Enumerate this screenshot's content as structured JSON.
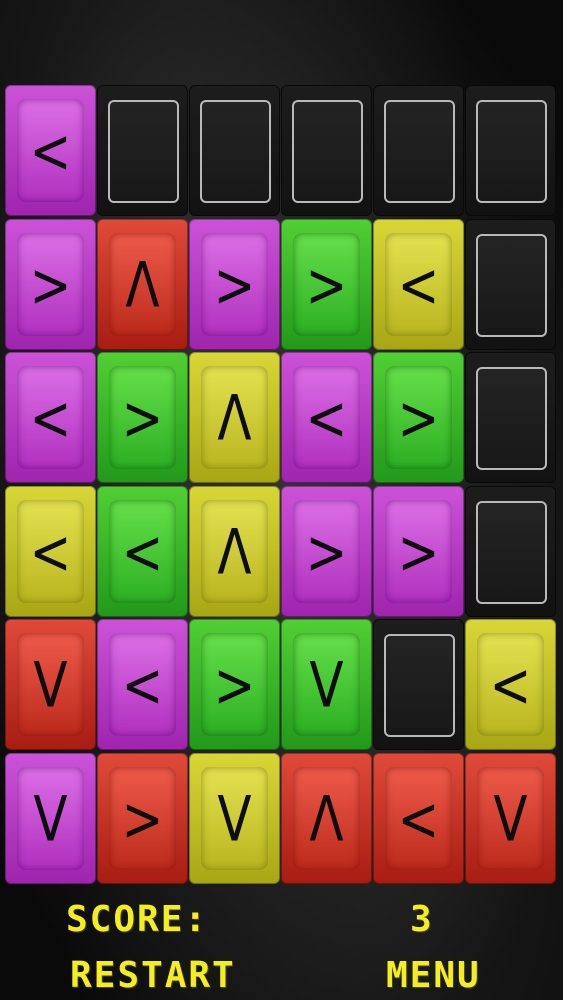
{
  "game": {
    "rows": 6,
    "cols": 6,
    "grid": [
      [
        {
          "color": "purple",
          "arrow": "<"
        },
        null,
        null,
        null,
        null,
        null
      ],
      [
        {
          "color": "purple",
          "arrow": ">"
        },
        {
          "color": "red",
          "arrow": "Λ"
        },
        {
          "color": "purple",
          "arrow": ">"
        },
        {
          "color": "green",
          "arrow": ">"
        },
        {
          "color": "yellow",
          "arrow": "<"
        },
        null
      ],
      [
        {
          "color": "purple",
          "arrow": "<"
        },
        {
          "color": "green",
          "arrow": ">"
        },
        {
          "color": "yellow",
          "arrow": "Λ"
        },
        {
          "color": "purple",
          "arrow": "<"
        },
        {
          "color": "green",
          "arrow": ">"
        },
        null
      ],
      [
        {
          "color": "yellow",
          "arrow": "<"
        },
        {
          "color": "green",
          "arrow": "<"
        },
        {
          "color": "yellow",
          "arrow": "Λ"
        },
        {
          "color": "purple",
          "arrow": ">"
        },
        {
          "color": "purple",
          "arrow": ">"
        },
        null
      ],
      [
        {
          "color": "red",
          "arrow": "V"
        },
        {
          "color": "purple",
          "arrow": "<"
        },
        {
          "color": "green",
          "arrow": ">"
        },
        {
          "color": "green",
          "arrow": "V"
        },
        null,
        {
          "color": "yellow",
          "arrow": "<"
        }
      ],
      [
        {
          "color": "purple",
          "arrow": "V"
        },
        {
          "color": "red",
          "arrow": ">"
        },
        {
          "color": "yellow",
          "arrow": "V"
        },
        {
          "color": "red",
          "arrow": "Λ"
        },
        {
          "color": "red",
          "arrow": "<"
        },
        {
          "color": "red",
          "arrow": "V"
        }
      ]
    ]
  },
  "hud": {
    "score_label": "SCORE:",
    "score_value": "3",
    "restart_label": "RESTART",
    "menu_label": "MENU"
  },
  "colors": {
    "hud_text": "#f3ee1f",
    "purple": "#b030be",
    "red": "#bc2a1c",
    "green": "#2cae23",
    "yellow": "#b8b51f",
    "empty_slot_border": "#b9b9b9"
  }
}
